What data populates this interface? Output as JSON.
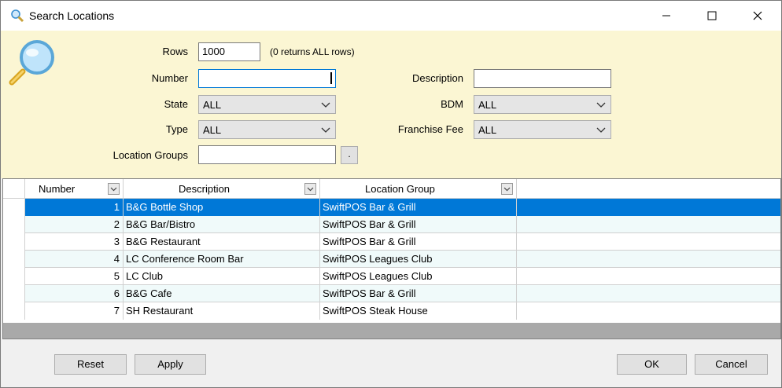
{
  "window": {
    "title": "Search Locations"
  },
  "filter": {
    "rows_label": "Rows",
    "rows_value": "1000",
    "rows_hint": "(0 returns ALL rows)",
    "number_label": "Number",
    "number_value": "",
    "description_label": "Description",
    "description_value": "",
    "state_label": "State",
    "state_value": "ALL",
    "bdm_label": "BDM",
    "bdm_value": "ALL",
    "type_label": "Type",
    "type_value": "ALL",
    "franchise_label": "Franchise Fee",
    "franchise_value": "ALL",
    "groups_label": "Location Groups",
    "groups_value": "",
    "groups_button": "."
  },
  "grid": {
    "headers": [
      "Number",
      "Description",
      "Location Group"
    ],
    "rows": [
      {
        "number": "1",
        "description": "B&G Bottle Shop",
        "group": "SwiftPOS Bar & Grill"
      },
      {
        "number": "2",
        "description": "B&G Bar/Bistro",
        "group": "SwiftPOS Bar & Grill"
      },
      {
        "number": "3",
        "description": "B&G Restaurant",
        "group": "SwiftPOS Bar & Grill"
      },
      {
        "number": "4",
        "description": "LC Conference Room Bar",
        "group": "SwiftPOS Leagues Club"
      },
      {
        "number": "5",
        "description": "LC Club",
        "group": "SwiftPOS Leagues Club"
      },
      {
        "number": "6",
        "description": "B&G Cafe",
        "group": "SwiftPOS Bar & Grill"
      },
      {
        "number": "7",
        "description": "SH Restaurant",
        "group": "SwiftPOS Steak House"
      }
    ]
  },
  "buttons": {
    "reset": "Reset",
    "apply": "Apply",
    "ok": "OK",
    "cancel": "Cancel"
  },
  "colors": {
    "filter_bg": "#fbf6d3",
    "selection": "#0078d7",
    "alt_row": "#f0fafa"
  }
}
